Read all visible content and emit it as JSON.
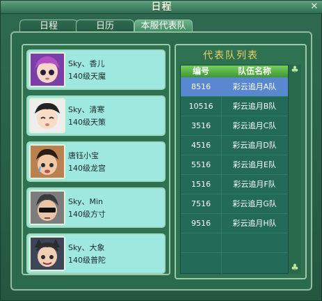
{
  "window": {
    "title": "日程"
  },
  "tabs": [
    {
      "label": "日程"
    },
    {
      "label": "日历"
    },
    {
      "label": "本服代表队"
    }
  ],
  "cards": [
    {
      "name": "Sky、香儿",
      "level": "140级天魔"
    },
    {
      "name": "Sky、清寒",
      "level": "140级天策"
    },
    {
      "name": "唐钰小宝",
      "level": "140级龙宫"
    },
    {
      "name": "Sky、Min",
      "level": "140级方寸"
    },
    {
      "name": "Sky、大象",
      "level": "140级普陀"
    }
  ],
  "team_list": {
    "title": "代表队列表",
    "headers": [
      "编号",
      "队伍名称"
    ],
    "rows": [
      {
        "id": "8516",
        "team": "彩云追月A队"
      },
      {
        "id": "10516",
        "team": "彩云追月B队"
      },
      {
        "id": "3516",
        "team": "彩云追月C队"
      },
      {
        "id": "4516",
        "team": "彩云追月D队"
      },
      {
        "id": "5516",
        "team": "彩云追月E队"
      },
      {
        "id": "1516",
        "team": "彩云追月F队"
      },
      {
        "id": "7516",
        "team": "彩云追月G队"
      },
      {
        "id": "9516",
        "team": "彩云追月H队"
      }
    ]
  },
  "icons": {
    "close": "close-icon",
    "scroll_up": "clover-up-icon",
    "scroll_down": "clover-down-icon"
  },
  "colors": {
    "accent_title": "#f0d060",
    "selected_row": "#5a88d0",
    "header_green": "#5cbf48"
  }
}
